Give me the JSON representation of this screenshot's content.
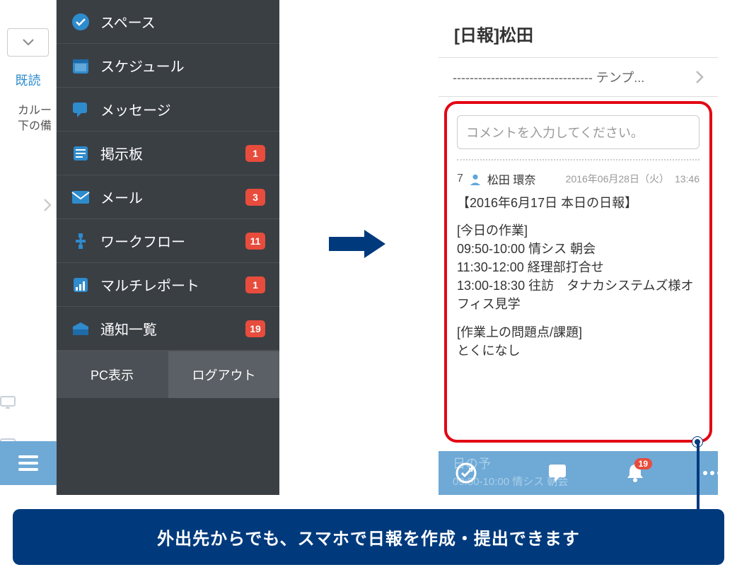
{
  "left": {
    "kidoku": "既読",
    "partial_text": "カルー\n下の備",
    "menu": [
      {
        "label": "スペース",
        "badge": null,
        "icon": "check-circle-icon"
      },
      {
        "label": "スケジュール",
        "badge": null,
        "icon": "calendar-icon"
      },
      {
        "label": "メッセージ",
        "badge": null,
        "icon": "speech-icon"
      },
      {
        "label": "掲示板",
        "badge": "1",
        "icon": "board-icon"
      },
      {
        "label": "メール",
        "badge": "3",
        "icon": "mail-icon"
      },
      {
        "label": "ワークフロー",
        "badge": "11",
        "icon": "workflow-icon"
      },
      {
        "label": "マルチレポート",
        "badge": "1",
        "icon": "report-icon"
      },
      {
        "label": "通知一覧",
        "badge": "19",
        "icon": "inbox-icon"
      }
    ],
    "footer": {
      "pc_view": "PC表示",
      "logout": "ログアウト"
    }
  },
  "right": {
    "header_title": "[日報]松田",
    "template_row": "--------------------------------- テンプ...",
    "comment_placeholder": "コメントを入力してください。",
    "post": {
      "number": "7",
      "author": "松田 環奈",
      "date": "2016年06月28日（火）",
      "time": "13:46",
      "title": "【2016年6月17日 本日の日報】",
      "section1_header": "[今日の作業]",
      "section1_body": "09:50-10:00 情シス 朝会\n11:30-12:00 経理部打合せ\n13:00-18:30 往訪　タナカシステムズ様オフィス見学",
      "section2_header": "[作業上の問題点/課題]",
      "section2_body": "とくになし"
    },
    "bottombar": {
      "ghost_line1": "日の予",
      "ghost_line2": "09:50-10:00 情シス 朝会",
      "notif_badge": "19"
    }
  },
  "caption": "外出先からでも、スマホで日報を作成・提出できます"
}
